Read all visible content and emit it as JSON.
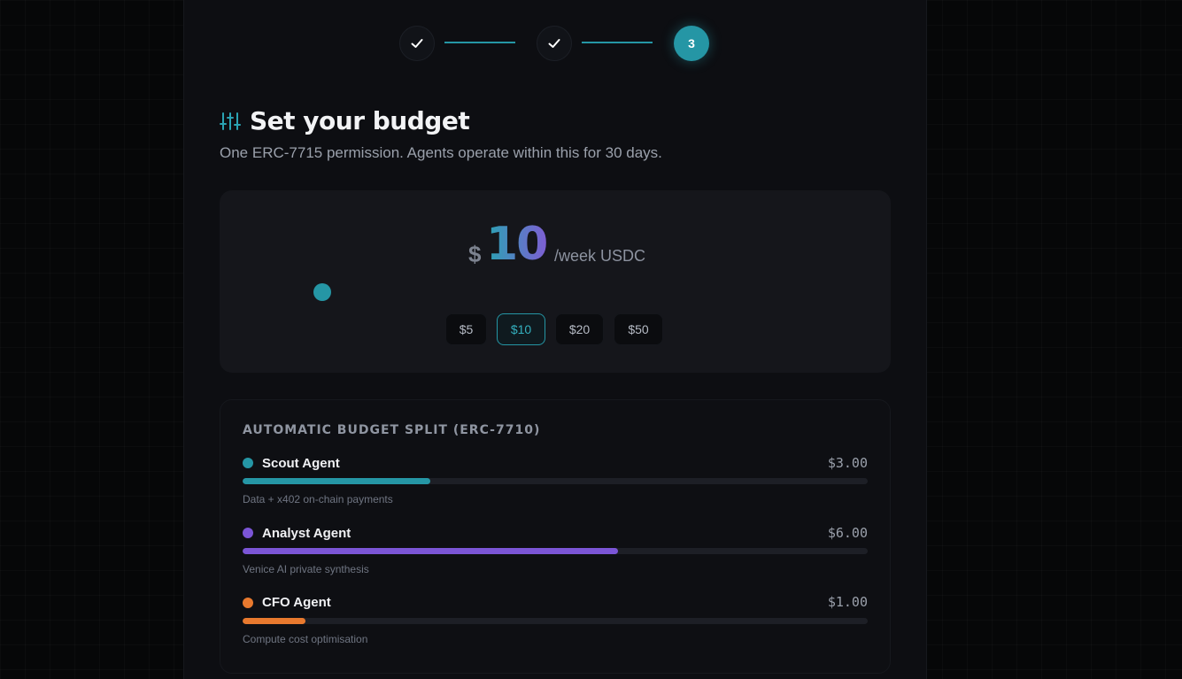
{
  "stepper": {
    "steps": [
      {
        "state": "done",
        "icon": "check-icon"
      },
      {
        "state": "done",
        "icon": "check-icon"
      },
      {
        "state": "active",
        "label": "3"
      }
    ]
  },
  "header": {
    "icon": "sliders-icon",
    "title": "Set your budget",
    "subtitle": "One ERC-7715 permission. Agents operate within this for 30 days."
  },
  "budget": {
    "currency_symbol": "$",
    "amount": "10",
    "unit": "/week USDC",
    "presets": [
      "$5",
      "$10",
      "$20",
      "$50"
    ],
    "selected_preset": "$10"
  },
  "split": {
    "title": "AUTOMATIC BUDGET SPLIT (ERC-7710)",
    "agents": [
      {
        "name": "Scout Agent",
        "amount": "$3.00",
        "description": "Data + x402 on-chain payments",
        "color": "#2596a5",
        "share": 0.3
      },
      {
        "name": "Analyst Agent",
        "amount": "$6.00",
        "description": "Venice AI private synthesis",
        "color": "#7b55d6",
        "share": 0.6
      },
      {
        "name": "CFO Agent",
        "amount": "$1.00",
        "description": "Compute cost optimisation",
        "color": "#e8792e",
        "share": 0.1
      }
    ]
  },
  "colors": {
    "accent": "#2596a5",
    "purple": "#7b55d6",
    "orange": "#e8792e",
    "background": "#0d0e12"
  }
}
